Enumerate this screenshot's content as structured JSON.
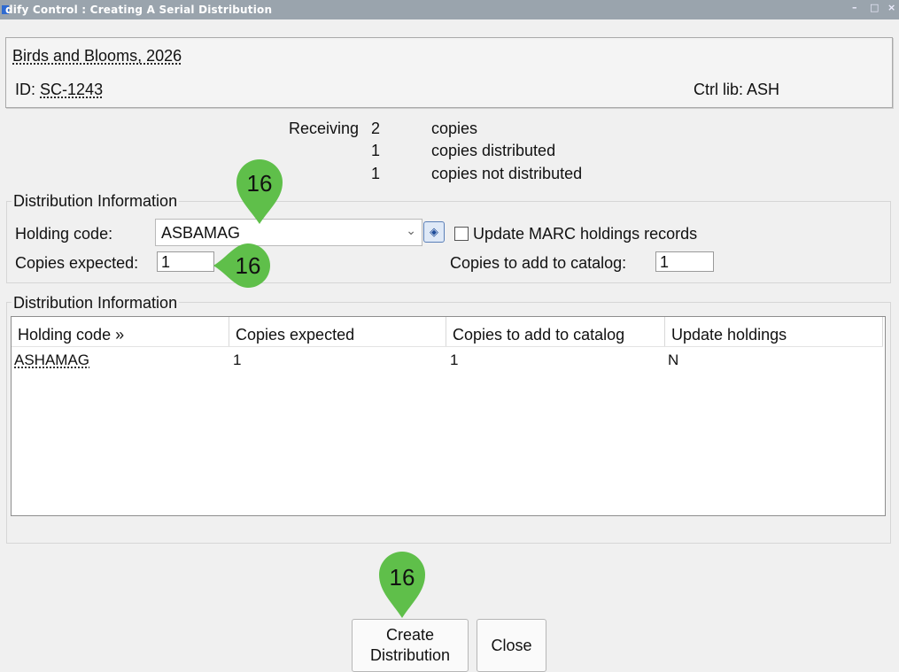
{
  "window": {
    "title": "dify Control : Creating A Serial Distribution",
    "minimize": "–",
    "maximize": "□",
    "close": "×"
  },
  "header": {
    "title": "Birds and Blooms, 2026",
    "id_label": "ID:",
    "id_value": "SC-1243",
    "ctrl_lib": "Ctrl lib: ASH"
  },
  "summary": {
    "receiving_label": "Receiving",
    "receiving_count": "2",
    "receiving_text": "copies",
    "distributed_count": "1",
    "distributed_text": "copies distributed",
    "not_distributed_count": "1",
    "not_distributed_text": "copies not distributed"
  },
  "form": {
    "group_label": "Distribution Information",
    "holding_code_label": "Holding code:",
    "holding_code_value": "ASBAMAG",
    "update_marc_label": "Update MARC holdings records",
    "copies_expected_label": "Copies expected:",
    "copies_expected_value": "1",
    "copies_to_add_label": "Copies to add to catalog:",
    "copies_to_add_value": "1"
  },
  "table": {
    "group_label": "Distribution Information",
    "columns": [
      "Holding code »",
      "Copies expected",
      "Copies to add to catalog",
      "Update holdings"
    ],
    "rows": [
      {
        "holding_code": "ASHAMAG",
        "copies_expected": "1",
        "copies_to_add": "1",
        "update_holdings": "N"
      }
    ]
  },
  "buttons": {
    "create_line1": "Create",
    "create_line2": "Distribution",
    "close": "Close"
  },
  "markers": {
    "holding": "16",
    "copies": "16",
    "create": "16",
    "color": "#5fbf4a"
  }
}
